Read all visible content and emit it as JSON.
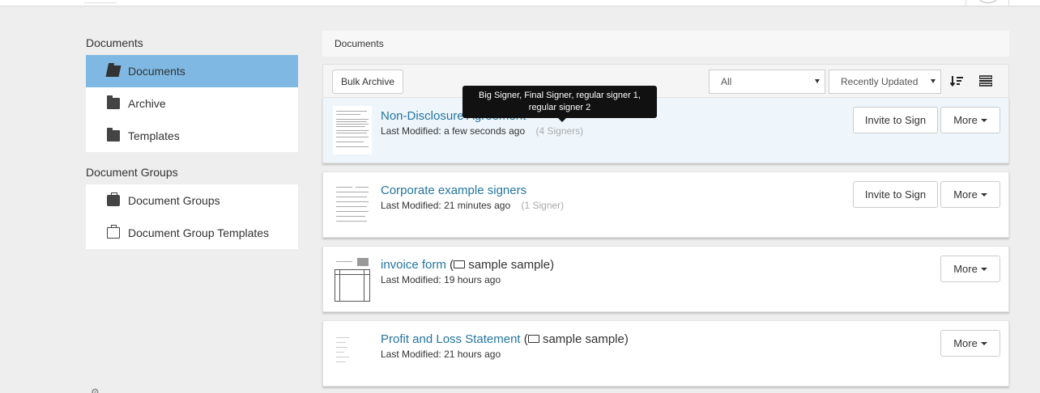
{
  "sidebar": {
    "documents_header": "Documents",
    "document_items": [
      {
        "label": "Documents"
      },
      {
        "label": "Archive"
      },
      {
        "label": "Templates"
      }
    ],
    "groups_header": "Document Groups",
    "group_items": [
      {
        "label": "Document Groups"
      },
      {
        "label": "Document Group Templates"
      }
    ]
  },
  "breadcrumb": "Documents",
  "toolbar": {
    "bulk_archive": "Bulk Archive",
    "filter_value": "All",
    "sort_value": "Recently Updated"
  },
  "tooltip": "Big Signer, Final Signer, regular signer 1, regular signer 2",
  "documents": [
    {
      "title": "Non-Disclosure Agreement",
      "meta_label": "Last Modified:",
      "modified": "a few seconds ago",
      "signers": "(4 Signers)",
      "invite_label": "Invite to Sign",
      "more_label": "More"
    },
    {
      "title": "Corporate example signers",
      "meta_label": "Last Modified:",
      "modified": "21 minutes ago",
      "signers": "(1 Signer)",
      "invite_label": "Invite to Sign",
      "more_label": "More"
    },
    {
      "title": "invoice form",
      "owner": "sample sample)",
      "meta_label": "Last Modified:",
      "modified": "19 hours ago",
      "more_label": "More"
    },
    {
      "title": "Profit and Loss Statement",
      "owner": "sample sample)",
      "meta_label": "Last Modified:",
      "modified": "21 hours ago",
      "more_label": "More"
    }
  ]
}
